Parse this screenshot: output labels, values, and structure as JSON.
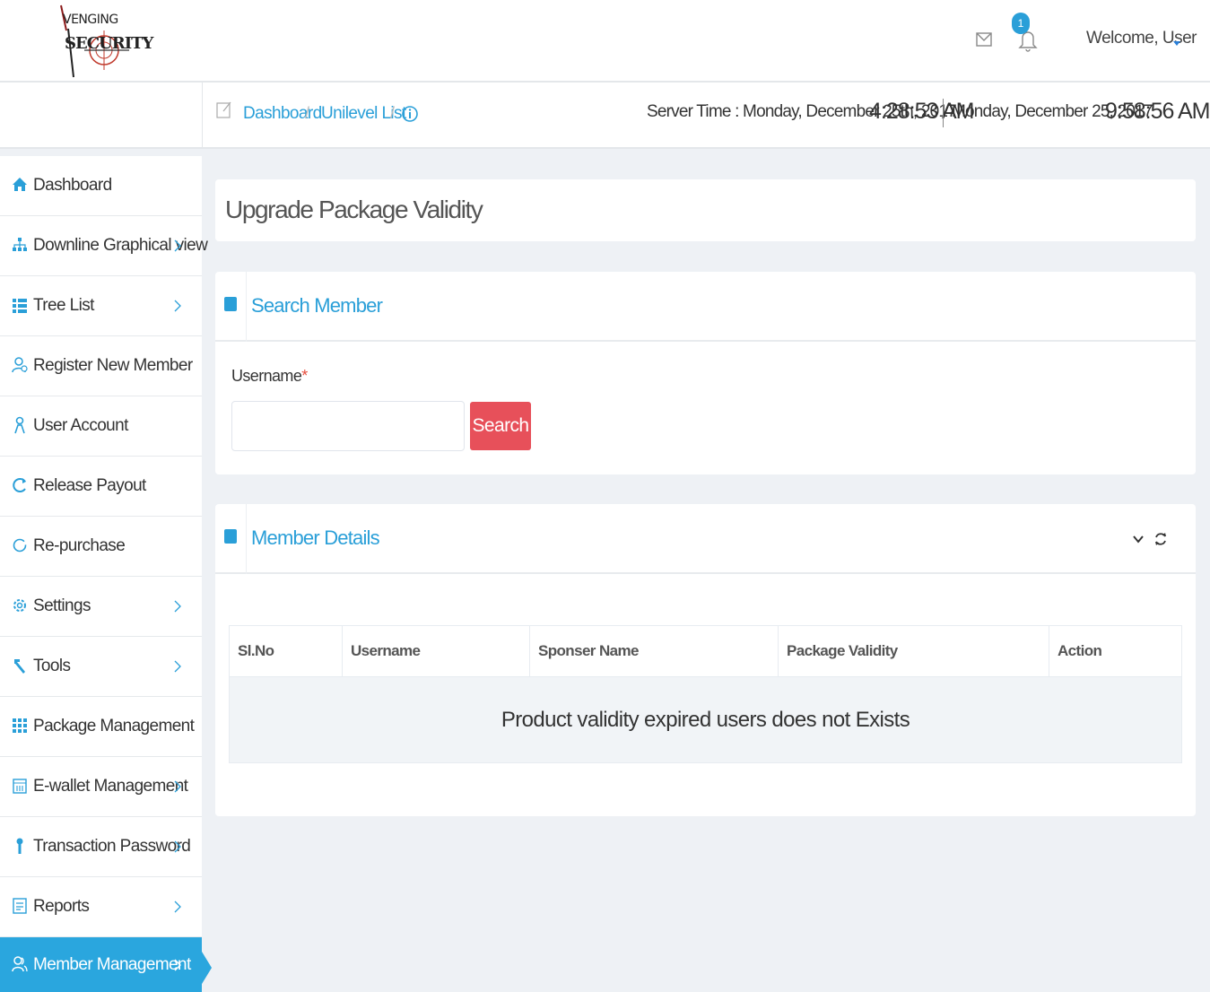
{
  "header": {
    "logo_line1": "VENGING",
    "logo_line2": "SECURITY",
    "notification_count": "1",
    "welcome": "Welcome, User",
    "icons": [
      "mail-icon",
      "bell-icon",
      "caret-down-icon"
    ]
  },
  "breadcrumb": {
    "items": [
      "Dashboard",
      "Unilevel List"
    ],
    "separator": "/"
  },
  "time": {
    "server_label": "Server Time : Monday, December 25th, 2017",
    "server_clock": "4:28:53 AM",
    "local_date": "Monday, December 25, 2017",
    "local_clock": "9:58:56 AM"
  },
  "sidebar": {
    "items": [
      {
        "label": "Dashboard",
        "icon": "home-icon",
        "arrow": false
      },
      {
        "label": "Downline Graphical view",
        "icon": "sitemap-icon",
        "arrow": true
      },
      {
        "label": "Tree List",
        "icon": "list-icon",
        "arrow": true
      },
      {
        "label": "Register New Member",
        "icon": "user-add-icon",
        "arrow": false
      },
      {
        "label": "User Account",
        "icon": "user-icon",
        "arrow": false
      },
      {
        "label": "Release Payout",
        "icon": "refresh-icon",
        "arrow": false
      },
      {
        "label": "Re-purchase",
        "icon": "circle-icon",
        "arrow": false
      },
      {
        "label": "Settings",
        "icon": "gear-icon",
        "arrow": true
      },
      {
        "label": "Tools",
        "icon": "wrench-icon",
        "arrow": true
      },
      {
        "label": "Package Management",
        "icon": "grid-icon",
        "arrow": false
      },
      {
        "label": "E-wallet Management",
        "icon": "calendar-icon",
        "arrow": true
      },
      {
        "label": "Transaction Password",
        "icon": "key-icon",
        "arrow": true
      },
      {
        "label": "Reports",
        "icon": "report-icon",
        "arrow": true
      },
      {
        "label": "Member Management",
        "icon": "users-icon",
        "arrow": true,
        "active": true
      }
    ]
  },
  "page": {
    "title": "Upgrade Package Validity"
  },
  "search_panel": {
    "title": "Search Member",
    "username_label": "Username",
    "required_mark": "*",
    "username_value": "",
    "button_label": "Search"
  },
  "details_panel": {
    "title": "Member Details",
    "columns": [
      "Sl.No",
      "Username",
      "Sponser Name",
      "Package Validity",
      "Action"
    ],
    "empty_message": "Product validity expired users does not Exists"
  },
  "colors": {
    "accent": "#2a9fd8",
    "active_sidebar": "#2aa6de",
    "search_button": "#e7505a"
  }
}
